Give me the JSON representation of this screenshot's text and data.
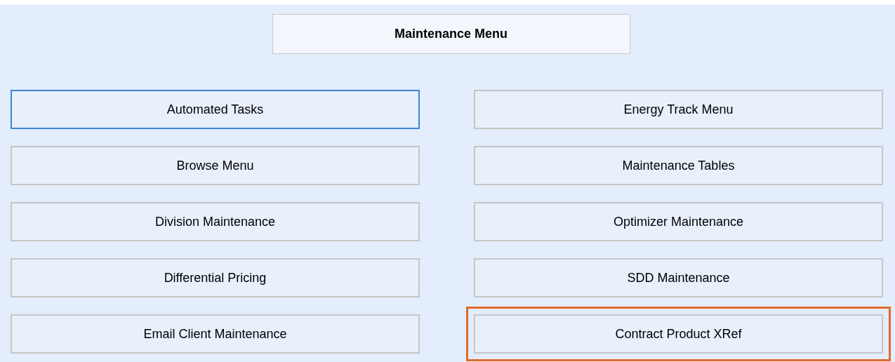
{
  "title": "Maintenance Menu",
  "left_column": [
    {
      "label": "Automated Tasks",
      "focused": true,
      "highlighted": false
    },
    {
      "label": "Browse Menu",
      "focused": false,
      "highlighted": false
    },
    {
      "label": "Division Maintenance",
      "focused": false,
      "highlighted": false
    },
    {
      "label": "Differential Pricing",
      "focused": false,
      "highlighted": false
    },
    {
      "label": "Email Client Maintenance",
      "focused": false,
      "highlighted": false
    }
  ],
  "right_column": [
    {
      "label": "Energy Track Menu",
      "focused": false,
      "highlighted": false
    },
    {
      "label": "Maintenance Tables",
      "focused": false,
      "highlighted": false
    },
    {
      "label": "Optimizer Maintenance",
      "focused": false,
      "highlighted": false
    },
    {
      "label": "SDD Maintenance",
      "focused": false,
      "highlighted": false
    },
    {
      "label": "Contract Product XRef",
      "focused": false,
      "highlighted": true
    }
  ]
}
